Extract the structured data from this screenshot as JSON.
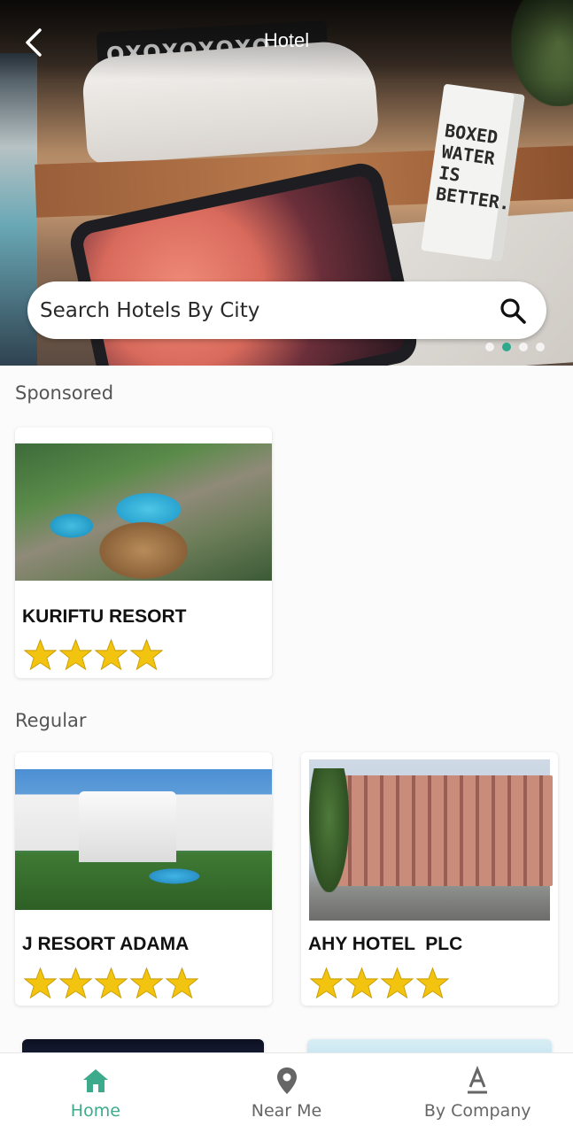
{
  "header": {
    "title": "Hotel",
    "back_icon": "chevron-left-icon"
  },
  "hero": {
    "carousel_total": 4,
    "carousel_active_index": 1,
    "accent_color": "#2fa98e",
    "photo_text": "BOXED WATER IS BETTER."
  },
  "search": {
    "placeholder": "Search Hotels By City",
    "icon": "search-icon"
  },
  "sections": {
    "sponsored_label": "Sponsored",
    "regular_label": "Regular"
  },
  "sponsored": [
    {
      "name": "KURIFTU RESORT",
      "stars": 4
    }
  ],
  "regular": [
    {
      "name": "J RESORT ADAMA",
      "stars": 5
    },
    {
      "name": "AHY HOTEL  PLC",
      "stars": 4
    }
  ],
  "bottom_nav": {
    "active_color": "#3daa8c",
    "items": [
      {
        "label": "Home",
        "icon": "home-icon",
        "active": true
      },
      {
        "label": "Near Me",
        "icon": "location-pin-icon",
        "active": false
      },
      {
        "label": "By Company",
        "icon": "company-letter-a-icon",
        "active": false
      }
    ]
  },
  "star_color": "#f2c40f"
}
